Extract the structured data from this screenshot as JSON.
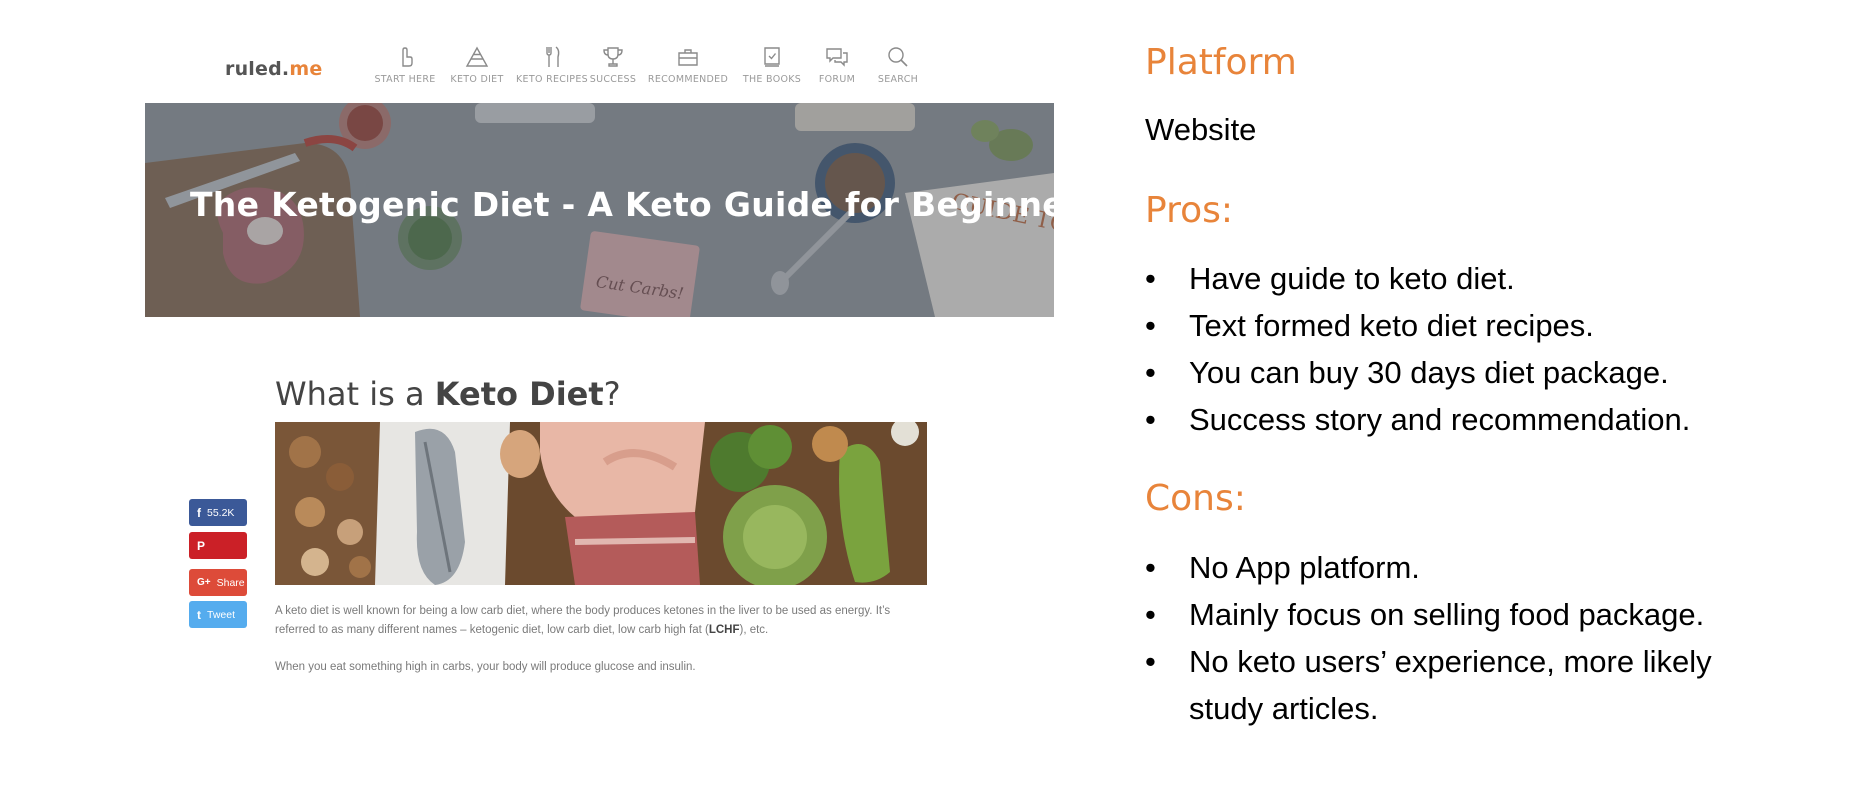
{
  "site": {
    "logo_main": "ruled.",
    "logo_accent": "me",
    "nav": [
      {
        "label": "START HERE",
        "icon": "hand-pointer-icon"
      },
      {
        "label": "KETO DIET",
        "icon": "pyramid-icon"
      },
      {
        "label": "KETO RECIPES",
        "icon": "fork-knife-icon"
      },
      {
        "label": "SUCCESS",
        "icon": "trophy-icon"
      },
      {
        "label": "RECOMMENDED",
        "icon": "briefcase-icon"
      },
      {
        "label": "THE BOOKS",
        "icon": "book-check-icon"
      },
      {
        "label": "FORUM",
        "icon": "chat-bubbles-icon"
      },
      {
        "label": "SEARCH",
        "icon": "search-icon"
      }
    ],
    "hero_title": "The Ketogenic Diet - A Keto Guide for Beginners",
    "hero_props": {
      "card_text": "Cut Carbs!",
      "book_text": "GUIDE TO KETO"
    },
    "article_title_prefix": "What is a ",
    "article_title_bold": "Keto Diet",
    "article_title_suffix": "?",
    "share": {
      "facebook_count": "55.2K",
      "facebook_icon": "f",
      "pinterest_icon": "P",
      "gplus_icon": "G+",
      "gplus_label": "Share",
      "twitter_icon": "t",
      "twitter_label": "Tweet"
    },
    "para1_before": "A keto diet is well known for being a low carb diet, where the body produces ketones in the liver to be used as energy. It’s referred to as many different names – ketogenic diet, low carb diet, low carb high fat (",
    "para1_bold": "LCHF",
    "para1_after": "), etc.",
    "para2": "When you eat something high in carbs, your body will produce glucose and insulin.",
    "colors": {
      "accent": "#e8843a",
      "facebook": "#3b5998",
      "pinterest": "#cb2027",
      "gplus": "#dd4b39",
      "twitter": "#55acee"
    }
  },
  "panel": {
    "platform_heading": "Platform",
    "platform_value": "Website",
    "pros_heading": "Pros:",
    "pros": [
      "Have guide to keto diet.",
      "Text formed keto diet recipes.",
      "You can buy 30 days diet package.",
      "Success story and recommendation."
    ],
    "cons_heading": "Cons:",
    "cons": [
      "No App platform.",
      "Mainly focus on selling food package.",
      "No keto users’ experience, more likely",
      "study articles."
    ]
  }
}
